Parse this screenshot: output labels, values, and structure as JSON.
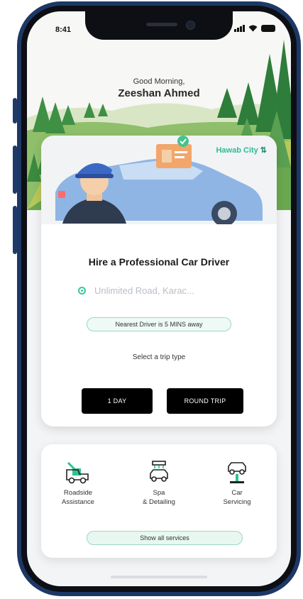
{
  "status_bar": {
    "time": "8:41"
  },
  "header": {
    "greeting": "Good Morning,",
    "user_name": "Zeeshan Ahmed"
  },
  "booking": {
    "city": "Hawab City",
    "title": "Hire a Professional Car Driver",
    "location_placeholder": "Unlimited Road, Karac...",
    "nearest_driver": "Nearest Driver is 5 MINS away",
    "trip_type_label": "Select a trip type",
    "trip_types": [
      "1 DAY",
      "ROUND TRIP"
    ]
  },
  "services": {
    "items": [
      {
        "line1": "Roadside",
        "line2": "Assistance",
        "icon": "tow-truck-icon"
      },
      {
        "line1": "Spa",
        "line2": "& Detailing",
        "icon": "car-wash-icon"
      },
      {
        "line1": "Car",
        "line2": "Servicing",
        "icon": "car-lift-icon"
      }
    ],
    "show_all": "Show all services"
  },
  "colors": {
    "accent": "#2dbb93",
    "frame": "#1d3866",
    "button": "#000000",
    "car": "#8fb5e4"
  }
}
